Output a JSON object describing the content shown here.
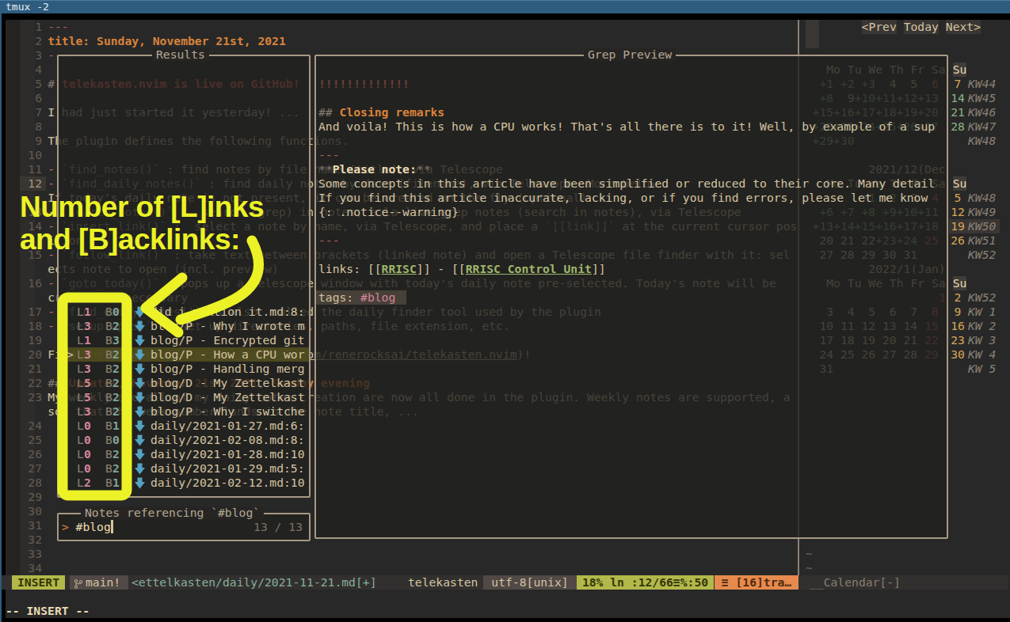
{
  "window": {
    "titlebar_title": "tmux  -2"
  },
  "annotation": {
    "line1": "Number of [L]inks",
    "line2": "and [B]acklinks:"
  },
  "editor": {
    "buffer_rows": [
      {
        "row": 0,
        "segs": [
          [
            "---",
            "mdrule"
          ]
        ]
      },
      {
        "row": 1,
        "segs": [
          [
            "title: Sunday, November 21st, 2021",
            "titleline"
          ]
        ]
      },
      {
        "row": 2,
        "segs": [
          [
            "---",
            "mdrule"
          ]
        ]
      },
      {
        "row": 4,
        "segs": [
          [
            "# ",
            "hmark"
          ],
          [
            "telekasten.nvim is live on GitHub!",
            "h1"
          ]
        ]
      },
      {
        "row": 6,
        "segs": [
          [
            "I had just started it yesterday! ...",
            "fg"
          ]
        ]
      },
      {
        "row": 8,
        "segs": [
          [
            "The plugin defines the following functions.",
            "fg"
          ]
        ]
      },
      {
        "row": 10,
        "segs": [
          [
            "- ",
            "bullet"
          ],
          [
            "`find_notes()`",
            "code"
          ],
          [
            " : find notes by file name (title), via Telescope",
            "fg"
          ]
        ]
      },
      {
        "row": 11,
        "segs": [
          [
            "- ",
            "bullet"
          ],
          [
            "`find_daily_notes()`",
            "code"
          ],
          [
            " : find daily notes by date (filename), via Telescope. More below.",
            "fg"
          ]
        ]
      },
      {
        "row": 12,
        "segs": [
          [
            "If today's daily note is not present, it can be created on the fly (optional)",
            "fg"
          ]
        ]
      },
      {
        "row": 13,
        "segs": [
          [
            "- ",
            "bullet"
          ],
          [
            "`search_notes()`",
            "code"
          ],
          [
            " :  search (grep) in notes, a la live_grep notes (search in notes), via Telescope",
            "fg"
          ]
        ]
      },
      {
        "row": 14,
        "segs": [
          [
            "- ",
            "bullet"
          ],
          [
            "`insert_link()`",
            "code"
          ],
          [
            " :  select a note by name, via Telescope, and place a ",
            "fg"
          ],
          [
            "`[[link]]`",
            "code"
          ],
          [
            " at the current cursor pos",
            "fg"
          ]
        ]
      },
      {
        "row": 15,
        "segs": [
          [
            "ition",
            "fg"
          ]
        ]
      },
      {
        "row": 16,
        "segs": [
          [
            "- ",
            "bullet"
          ],
          [
            "`follow_link()`",
            "code"
          ],
          [
            " : take text between brackets (linked note) and open a Telescope file finder with it: sel",
            "fg"
          ]
        ]
      },
      {
        "row": 17,
        "segs": [
          [
            "ects note to open (incl. preview)",
            "fg"
          ]
        ]
      },
      {
        "row": 18,
        "segs": [
          [
            "- ",
            "bullet"
          ],
          [
            "`goto_today()`",
            "code"
          ],
          [
            " : pops up a Telescope window with today's daily note pre-selected. Today's note will be",
            "fg"
          ]
        ]
      },
      {
        "row": 19,
        "segs": [
          [
            "created if necessary",
            "fg"
          ]
        ]
      },
      {
        "row": 20,
        "segs": [
          [
            "- ",
            "bullet"
          ],
          [
            "`find_daily_notes()`",
            "code"
          ],
          [
            " is also  called ",
            "fg"
          ],
          [
            "the daily finder tool used by the plugin",
            "fg"
          ]
        ]
      },
      {
        "row": 21,
        "segs": [
          [
            "- ",
            "bullet"
          ],
          [
            "`setup(opts)`",
            "code"
          ],
          [
            " :  set up directories, paths, file extension, etc.",
            "fg"
          ]
        ]
      },
      {
        "row": 23,
        "segs": [
          [
            "Find the plugin at: (",
            "fg"
          ],
          [
            "https://github.com/renerocksai/telekasten.nvim",
            "url"
          ],
          [
            ")!",
            "fg"
          ]
        ]
      },
      {
        "row": 25,
        "segs": [
          [
            "## ",
            "hmark"
          ],
          [
            "Updates, November 21st 2021, Sunday evening",
            "h2"
          ]
        ]
      },
      {
        "row": 26,
        "segs": [
          [
            "My weekly and all of my daily notes cre",
            "fg"
          ],
          [
            "ation are now all done in the plugin. Weekly notes are supported, a",
            "fg"
          ]
        ]
      },
      {
        "row": 27,
        "segs": [
          [
            "so, that the week number lands in the n",
            "fg"
          ],
          [
            "ote title, ...",
            "fg"
          ]
        ]
      }
    ],
    "gutter": [
      {
        "row": 0,
        "num": "1"
      },
      {
        "row": 1,
        "num": "2"
      },
      {
        "row": 2,
        "num": "3"
      },
      {
        "row": 3,
        "num": "4"
      },
      {
        "row": 4,
        "num": "5"
      },
      {
        "row": 5,
        "num": "6"
      },
      {
        "row": 6,
        "num": "7"
      },
      {
        "row": 7,
        "num": "8"
      },
      {
        "row": 8,
        "num": "9"
      },
      {
        "row": 9,
        "num": "10"
      },
      {
        "row": 10,
        "num": "11"
      },
      {
        "row": 11,
        "num": "12"
      },
      {
        "row": 13,
        "num": "13"
      },
      {
        "row": 14,
        "num": "14"
      },
      {
        "row": 16,
        "num": "15"
      },
      {
        "row": 18,
        "num": "16"
      },
      {
        "row": 20,
        "num": "17"
      },
      {
        "row": 21,
        "num": "18"
      },
      {
        "row": 22,
        "num": "19"
      },
      {
        "row": 23,
        "num": "20"
      },
      {
        "row": 24,
        "num": "21"
      },
      {
        "row": 25,
        "num": "22"
      },
      {
        "row": 26,
        "num": "23"
      },
      {
        "row": 28,
        "num": "24"
      },
      {
        "row": 29,
        "num": "25"
      },
      {
        "row": 30,
        "num": "26"
      },
      {
        "row": 31,
        "num": "27"
      },
      {
        "row": 32,
        "num": "28"
      },
      {
        "row": 33,
        "num": "29"
      },
      {
        "row": 34,
        "num": "30"
      },
      {
        "row": 35,
        "num": "31"
      },
      {
        "row": 36,
        "num": "32"
      },
      {
        "row": 37,
        "num": "33"
      },
      {
        "row": 38,
        "num": "34"
      }
    ],
    "cursor_line_row": 11
  },
  "results": {
    "title": "Results",
    "items": [
      {
        "l": "L1",
        "b": "B0",
        "name": "did i mention it.md:8:",
        "selected": false
      },
      {
        "l": "L3",
        "b": "B2",
        "name": "blog/P - Why I wrote m",
        "selected": false
      },
      {
        "l": "L1",
        "b": "B3",
        "name": "blog/P - Encrypted git",
        "selected": false
      },
      {
        "l": "L3",
        "b": "B2",
        "name": "blog/P - How a CPU wor",
        "selected": true
      },
      {
        "l": "L3",
        "b": "B2",
        "name": "blog/P - Handling merg",
        "selected": false
      },
      {
        "l": "L5",
        "b": "B2",
        "name": "blog/D - My Zettelkast",
        "selected": false
      },
      {
        "l": "L5",
        "b": "B2",
        "name": "blog/D - My Zettelkast",
        "selected": false
      },
      {
        "l": "L3",
        "b": "B2",
        "name": "blog/P - Why I switche",
        "selected": false
      },
      {
        "l": "L0",
        "b": "B1",
        "name": "daily/2021-01-27.md:6:",
        "selected": false
      },
      {
        "l": "L0",
        "b": "B0",
        "name": "daily/2021-02-08.md:8:",
        "selected": false
      },
      {
        "l": "L0",
        "b": "B2",
        "name": "daily/2021-01-28.md:10",
        "selected": false
      },
      {
        "l": "L0",
        "b": "B2",
        "name": "daily/2021-01-29.md:5:",
        "selected": false
      },
      {
        "l": "L2",
        "b": "B1",
        "name": "daily/2021-02-12.md:10",
        "selected": false
      }
    ],
    "caret": ">"
  },
  "prompt": {
    "title": "Notes referencing `#blog`",
    "caret": ">",
    "query": "#blog",
    "count": "13 / 13"
  },
  "preview": {
    "title": "Grep Preview",
    "rows": [
      {
        "row": 4,
        "segs": [
          [
            "!!!!!!!!!!!!!",
            "dimred"
          ]
        ]
      },
      {
        "row": 6,
        "segs": [
          [
            "## ",
            "pmark"
          ],
          [
            "Closing remarks",
            "h2o"
          ]
        ]
      },
      {
        "row": 7,
        "segs": [
          [
            "And voila! This is how a CPU works! That's all there is to it! Well, by example of a sup",
            "pfg"
          ]
        ]
      },
      {
        "row": 9,
        "segs": [
          [
            "---",
            "prule"
          ]
        ]
      },
      {
        "row": 10,
        "segs": [
          [
            "**",
            "pmark"
          ],
          [
            "Please note:",
            "pbold"
          ],
          [
            "**",
            "pmark"
          ]
        ]
      },
      {
        "row": 11,
        "segs": [
          [
            "Some concepts in this article have been simplified or reduced to their core. Many detail",
            "pfg"
          ]
        ]
      },
      {
        "row": 12,
        "segs": [
          [
            "If you find this article inaccurate, lacking, or if you find errors, please let me know",
            "pfg"
          ]
        ]
      },
      {
        "row": 13,
        "segs": [
          [
            "{: .notice--warning}",
            "pfg"
          ]
        ]
      },
      {
        "row": 15,
        "segs": [
          [
            "---",
            "prule"
          ]
        ]
      },
      {
        "row": 17,
        "segs": [
          [
            "links: [[",
            "pfg"
          ],
          [
            "RRISC",
            "plink"
          ],
          [
            "]] - [[",
            "pfg"
          ],
          [
            "RRISC Control Unit",
            "plink"
          ],
          [
            "]]",
            "pfg"
          ]
        ]
      },
      {
        "row": 19,
        "segs": [
          [
            "tags: ",
            "ptag"
          ],
          [
            "#blog",
            "ppink"
          ]
        ],
        "match_hl": true
      }
    ]
  },
  "calendar": {
    "nav": [
      {
        "label": "<Prev"
      },
      {
        "label": "Today"
      },
      {
        "label": "Next>"
      }
    ],
    "weekday_header": "Mo Tu We Th Fr Sa",
    "sunday_header": "Su",
    "rows": [
      {
        "row": 3,
        "hdr": true
      },
      {
        "row": 4,
        "col": 116,
        "segs": [
          [
            "+1 +2 +3",
            "teal"
          ],
          [
            "  4  5",
            "cfg"
          ],
          [
            "  6",
            "sat"
          ]
        ],
        "su": "7",
        "suc": "yellow",
        "kw": "KW44"
      },
      {
        "row": 5,
        "col": 116,
        "segs": [
          [
            "+8",
            "teal"
          ],
          [
            "  9",
            "cfg"
          ],
          [
            "+10+11+12+13",
            "teal"
          ]
        ],
        "su": "14",
        "suc": "teal",
        "kw": "KW45"
      },
      {
        "row": 6,
        "col": 115,
        "segs": [
          [
            "+15+16+17+18+19+20",
            "teal"
          ]
        ],
        "su": "21",
        "suc": "teal",
        "kw": "KW46"
      },
      {
        "row": 7,
        "col": 115,
        "segs": [
          [
            "+22+23+24+25+26+27",
            "teal"
          ]
        ],
        "su": "28",
        "suc": "teal",
        "kw": "KW47"
      },
      {
        "row": 8,
        "col": 115,
        "segs": [
          [
            "+29+30",
            "teal"
          ]
        ],
        "su": "",
        "suc": "cfg",
        "kw": "KW48"
      },
      {
        "row": 10,
        "col": 123,
        "segs": [
          [
            "2021/12(Dec",
            "cfg"
          ]
        ]
      },
      {
        "row": 11,
        "hdr": true
      },
      {
        "row": 12,
        "col": 122,
        "segs": [
          [
            "+1 +2",
            "teal"
          ],
          [
            "  3",
            "cfg"
          ],
          [
            "  4",
            "sat"
          ]
        ],
        "su": "5",
        "suc": "yellow",
        "kw": "KW48"
      },
      {
        "row": 13,
        "col": 116,
        "segs": [
          [
            "+6 +7 +8 +9+10+11",
            "teal"
          ]
        ],
        "su": "12",
        "suc": "yellow",
        "kw": "KW49"
      },
      {
        "row": 14,
        "col": 115,
        "segs": [
          [
            "+13+14+15+16+17+18",
            "teal"
          ]
        ],
        "su": "19",
        "suc": "yellow",
        "kw": "KW50",
        "hl": true
      },
      {
        "row": 15,
        "col": 115,
        "segs": [
          [
            " 20 21 22",
            "cfg"
          ],
          [
            "+23+24",
            "teal"
          ],
          [
            " 25",
            "sat"
          ]
        ],
        "su": "26",
        "suc": "yellow",
        "kw": "KW51"
      },
      {
        "row": 16,
        "col": 115,
        "segs": [
          [
            " 27 28 29 30 31",
            "cfg"
          ]
        ],
        "su": "",
        "suc": "cfg",
        "kw": "KW52"
      },
      {
        "row": 17,
        "col": 123,
        "segs": [
          [
            "2022/1(Jan)",
            "cfg"
          ]
        ]
      },
      {
        "row": 18,
        "hdr": true
      },
      {
        "row": 19,
        "col": 131,
        "segs": [
          [
            "  1",
            "sat"
          ]
        ],
        "su": "2",
        "suc": "yellow",
        "kw": "KW52"
      },
      {
        "row": 20,
        "col": 115,
        "segs": [
          [
            "  3  4  5  6  7",
            "cfg"
          ],
          [
            "  8",
            "sat"
          ]
        ],
        "su": "9",
        "suc": "yellow",
        "kw": "KW 1"
      },
      {
        "row": 21,
        "col": 115,
        "segs": [
          [
            " 10 11 12 13 14",
            "cfg"
          ],
          [
            " 15",
            "sat"
          ]
        ],
        "su": "16",
        "suc": "yellow",
        "kw": "KW 2"
      },
      {
        "row": 22,
        "col": 115,
        "segs": [
          [
            " 17 18 19 20 21",
            "cfg"
          ],
          [
            " 22",
            "sat"
          ]
        ],
        "su": "23",
        "suc": "yellow",
        "kw": "KW 3"
      },
      {
        "row": 23,
        "col": 115,
        "segs": [
          [
            " 24 25 26 27 28",
            "cfg"
          ],
          [
            " 29",
            "sat"
          ]
        ],
        "su": "30",
        "suc": "yellow",
        "kw": "KW 4"
      },
      {
        "row": 24,
        "col": 115,
        "segs": [
          [
            " 31",
            "cfg"
          ]
        ],
        "su": "",
        "suc": "cfg",
        "kw": "KW 5"
      }
    ],
    "tilde_rows": [
      37,
      38
    ],
    "statusline": "__Calendar[-]"
  },
  "statusline": {
    "mode": "INSERT",
    "branch": "main!",
    "path": "<ettelkasten/daily/2021-11-21.md[+]",
    "plugin": "telekasten",
    "encoding": "utf-8[unix]",
    "progress": "18% ln :12/66≡%:50",
    "warning": "≡ [16]tra…"
  },
  "cmdline": "-- INSERT --",
  "colors": {
    "titlebar_bg": "#2d5c7e",
    "titlebar_fg": "#e8edf2",
    "blue_edge": "#2d5c7e",
    "term_bg": "#282828",
    "black": "#000000",
    "fg": "#d5c4a1",
    "fg_bright": "#e9dbb5",
    "gutter": "#655b51",
    "gutter_band": "#2e2c2a",
    "signcol": "#252221",
    "cursor_num_bg": "#3a3632",
    "cursor_num_fg": "#a59780",
    "orange": "#d8833b",
    "red_h1": "#ea6962",
    "bullet": "#c96a5d",
    "code": "#9da387",
    "mdrule": "#a95f5a",
    "hmark": "#837a6e",
    "pink": "#d3869b",
    "blue": "#83a598",
    "icon_blue": "#55a1c2",
    "border": "#a89984",
    "wintitle": "#b5a893",
    "float_bg": "rgba(33,32,30,0.80)",
    "sel_bg": "rgba(86,82,32,0.82)",
    "dim_red": "#6e4038",
    "rule_red": "#b16357",
    "white": "#ebdbb2",
    "green_link": "#9fb56c",
    "tag_pink": "#d3869b",
    "tag_bg": "#474038",
    "teal": "#89b482",
    "cal_yellow": "#d8a657",
    "cal_sat": "#c56b5c",
    "kw": "#8a8175",
    "cal_dim_hl": "#3a3633",
    "su_bg": "#403c38",
    "sep": "#8a8075",
    "tilde": "#6b6258",
    "sl_band": "#32302f",
    "sl_green_bg": "#b2b84a",
    "sl_green_fg": "#343607",
    "sl_gray_bg": "#504945",
    "sl_gray_fg": "#d5c4a1",
    "sl_orange_bg": "#e78a4e",
    "sl_orange_fg": "#502a0c",
    "sl_path": "#87ae9a",
    "sl_mid": "#d5c4a1",
    "sl_cal": "#867d6e",
    "prompt_caret": "#e2853d",
    "count": "#7c7264",
    "yellow": "#ecf226"
  }
}
